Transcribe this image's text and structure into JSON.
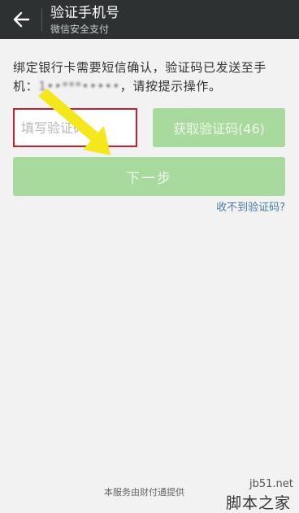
{
  "header": {
    "title": "验证手机号",
    "subtitle": "微信安全支付",
    "back_icon": "back-arrow-icon"
  },
  "message": {
    "text_before": "绑定银行卡需要短信确认，验证码已发送至手机：",
    "masked_phone": "1••***•••••",
    "text_after": "，请按提示操作。"
  },
  "code_field": {
    "placeholder": "填写验证码",
    "value": ""
  },
  "get_code_button": {
    "label": "获取验证码(46)"
  },
  "next_button": {
    "label": "下一步"
  },
  "no_code_link": {
    "label": "收不到验证码?"
  },
  "footer": {
    "text": "本服务由财付通提供"
  },
  "watermark": {
    "url": "jb51.net",
    "text": "脚本之家"
  },
  "colors": {
    "header_bg": "#2e3132",
    "page_bg": "#f2f2f2",
    "button_disabled_green": "#a8d99d",
    "highlight_red": "#c8202e",
    "annotation_yellow": "#f4e81c",
    "link_blue": "#4a7ba6"
  }
}
